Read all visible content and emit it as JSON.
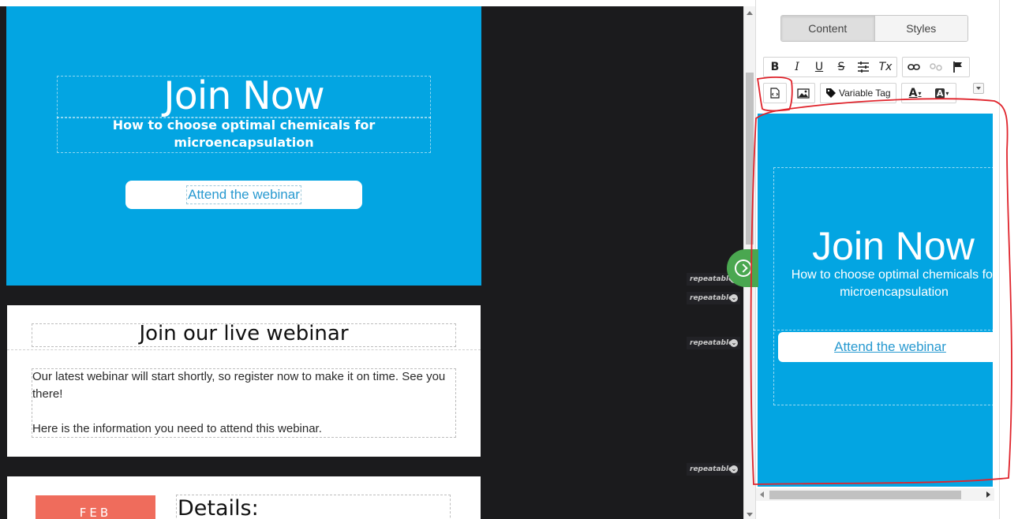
{
  "hero": {
    "title": "Join Now",
    "subtitle": "How to choose optimal chemicals for microencapsulation",
    "button_label": "Attend the webinar"
  },
  "section2": {
    "heading": "Join our live webinar",
    "paragraph1": "Our latest webinar will start shortly, so register now to make it on time. See you there!",
    "paragraph2": "Here is the information you need to attend this webinar."
  },
  "section3": {
    "month": "FEB",
    "details_heading": "Details:"
  },
  "repeatable_tags": [
    "repeatable",
    "repeatable",
    "repeatable",
    "repeatable"
  ],
  "panel": {
    "tabs": [
      {
        "label": "Content",
        "active": true
      },
      {
        "label": "Styles",
        "active": false
      }
    ],
    "toolbar": {
      "bold": "B",
      "italic": "I",
      "underline": "U",
      "strike": "S",
      "clear_format": "Tx",
      "variable_tag_label": "Variable Tag",
      "font_color": "A",
      "bg_color": "A"
    },
    "preview": {
      "title": "Join Now",
      "subtitle": "How to choose optimal chemicals for microencapsulation",
      "button_label": "Attend the webinar"
    }
  },
  "colors": {
    "hero_bg": "#03a5e2",
    "canvas_bg": "#1b1b1d",
    "toggle_green": "#4aa750",
    "date_badge": "#ef6c5c",
    "annotation_red": "#e0242c",
    "link_blue": "#2799d0"
  },
  "icons": [
    "source-code-icon",
    "image-icon",
    "tag-icon",
    "link-icon",
    "unlink-icon",
    "flag-icon",
    "text-align-icon",
    "chevron-right-circle-icon",
    "chevron-down-icon"
  ]
}
